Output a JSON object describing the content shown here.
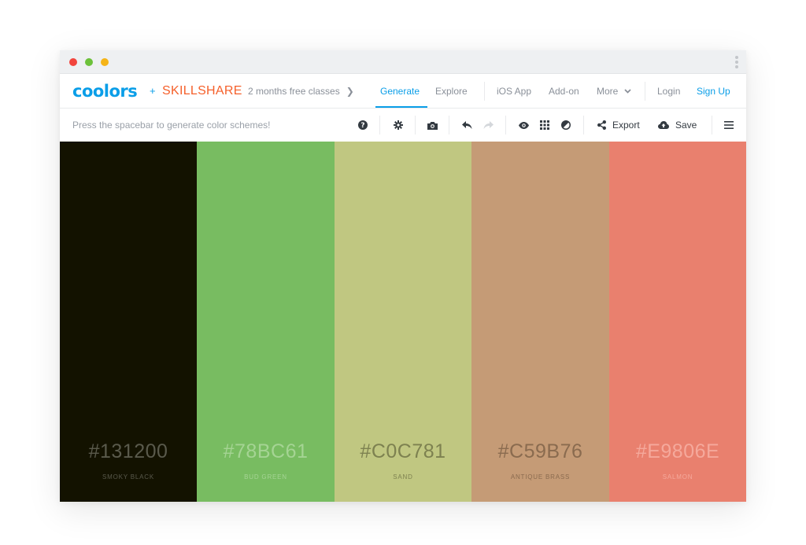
{
  "brand": {
    "logo": "coolors",
    "plus": "+",
    "partner": "SKILLSHARE"
  },
  "navbar": {
    "promo": "2 months free classes",
    "links": [
      "Generate",
      "Explore",
      "iOS App",
      "Add-on",
      "More",
      "Login",
      "Sign Up"
    ],
    "active": "Generate"
  },
  "toolbar": {
    "hint": "Press the spacebar to generate color schemes!",
    "export_label": "Export",
    "save_label": "Save",
    "icons": [
      "help-icon",
      "settings-icon",
      "camera-icon",
      "undo-icon",
      "redo-icon",
      "view-icon",
      "grid-icon",
      "adjust-icon",
      "share-icon",
      "cloud-save-icon",
      "menu-icon"
    ]
  },
  "palette": [
    {
      "hex": "#131200",
      "name": "SMOKY BLACK",
      "color": "#131200",
      "text_color": "#5a5a4c"
    },
    {
      "hex": "#78BC61",
      "name": "BUD GREEN",
      "color": "#78bc61",
      "text_color": "#a5d494"
    },
    {
      "hex": "#C0C781",
      "name": "SAND",
      "color": "#c0c781",
      "text_color": "#7d8150"
    },
    {
      "hex": "#C59B76",
      "name": "ANTIQUE BRASS",
      "color": "#c59b76",
      "text_color": "#8a6b4f"
    },
    {
      "hex": "#E9806E",
      "name": "SALMON",
      "color": "#e9806e",
      "text_color": "#f5a99c"
    }
  ],
  "colors": {
    "accent": "#0a9ee8",
    "skillshare": "#f5602b",
    "muted": "#8a9099"
  }
}
